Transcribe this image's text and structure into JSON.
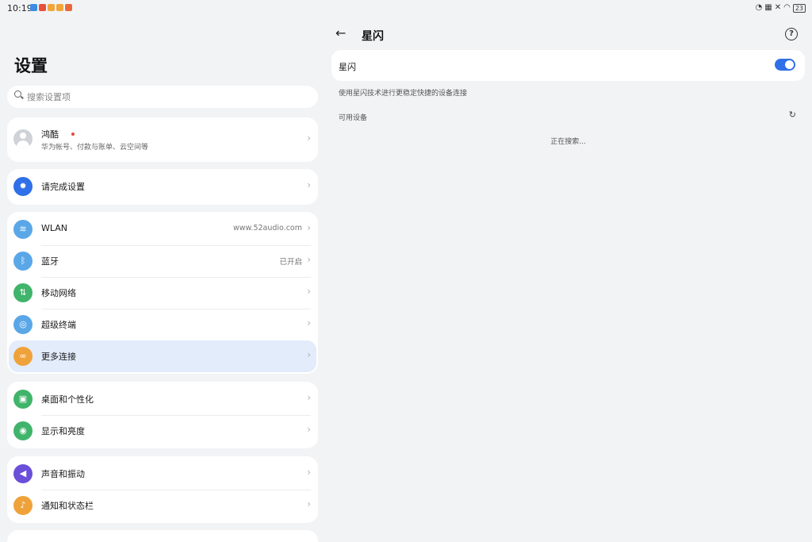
{
  "status_bar": {
    "time": "10:19",
    "battery": "23"
  },
  "settings": {
    "title": "设置",
    "search_placeholder": "搜索设置项",
    "account": {
      "name": "鸿酷",
      "subtitle": "华为帐号、付款与账单、云空间等"
    },
    "complete_setup": "请完成设置",
    "connectivity": [
      {
        "label": "WLAN",
        "value": "www.52audio.com",
        "icon": "wifi-icon",
        "color": "#5aa7e8"
      },
      {
        "label": "蓝牙",
        "value": "已开启",
        "icon": "bluetooth-icon",
        "color": "#5aa7e8"
      },
      {
        "label": "移动网络",
        "value": "",
        "icon": "mobile-network-icon",
        "color": "#3fb46a"
      },
      {
        "label": "超级终端",
        "value": "",
        "icon": "super-device-icon",
        "color": "#5aa7e8"
      },
      {
        "label": "更多连接",
        "value": "",
        "icon": "more-connections-icon",
        "color": "#f0a23a"
      }
    ],
    "personalization": [
      {
        "label": "桌面和个性化",
        "icon": "desktop-icon",
        "color": "#3fb46a"
      },
      {
        "label": "显示和亮度",
        "icon": "display-icon",
        "color": "#3fb46a"
      }
    ],
    "sound": [
      {
        "label": "声音和振动",
        "icon": "sound-icon",
        "color": "#6b4fd8"
      },
      {
        "label": "通知和状态栏",
        "icon": "notification-icon",
        "color": "#f0a23a"
      }
    ]
  },
  "detail": {
    "title": "星闪",
    "toggle_label": "星闪",
    "toggle_on": true,
    "description": "使用星闪技术进行更稳定快捷的设备连接",
    "available_devices": "可用设备",
    "searching": "正在搜索..."
  },
  "colors": {
    "accent": "#2f6fe8",
    "highlight": "#e3ecfb",
    "background": "#f1f3f5"
  }
}
